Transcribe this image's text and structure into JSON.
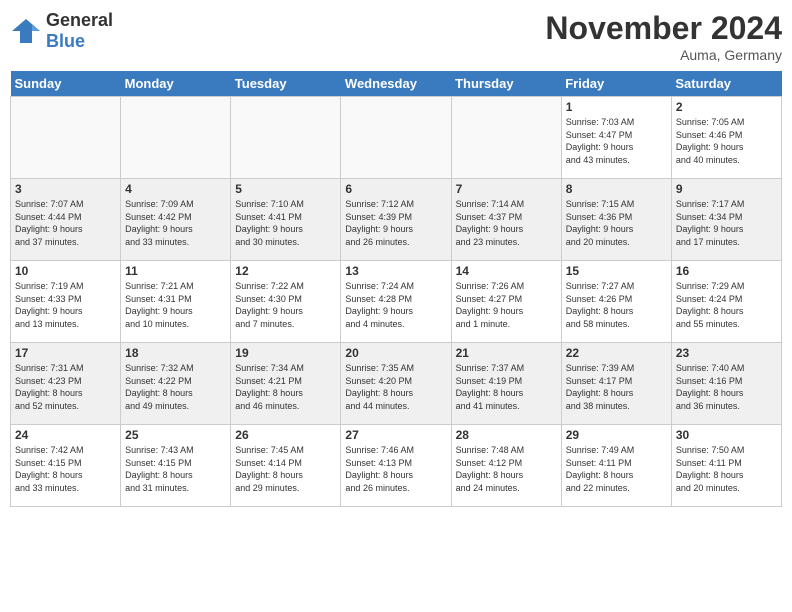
{
  "header": {
    "logo_general": "General",
    "logo_blue": "Blue",
    "month_title": "November 2024",
    "location": "Auma, Germany"
  },
  "days_of_week": [
    "Sunday",
    "Monday",
    "Tuesday",
    "Wednesday",
    "Thursday",
    "Friday",
    "Saturday"
  ],
  "weeks": [
    [
      {
        "day": "",
        "info": ""
      },
      {
        "day": "",
        "info": ""
      },
      {
        "day": "",
        "info": ""
      },
      {
        "day": "",
        "info": ""
      },
      {
        "day": "",
        "info": ""
      },
      {
        "day": "1",
        "info": "Sunrise: 7:03 AM\nSunset: 4:47 PM\nDaylight: 9 hours\nand 43 minutes."
      },
      {
        "day": "2",
        "info": "Sunrise: 7:05 AM\nSunset: 4:46 PM\nDaylight: 9 hours\nand 40 minutes."
      }
    ],
    [
      {
        "day": "3",
        "info": "Sunrise: 7:07 AM\nSunset: 4:44 PM\nDaylight: 9 hours\nand 37 minutes."
      },
      {
        "day": "4",
        "info": "Sunrise: 7:09 AM\nSunset: 4:42 PM\nDaylight: 9 hours\nand 33 minutes."
      },
      {
        "day": "5",
        "info": "Sunrise: 7:10 AM\nSunset: 4:41 PM\nDaylight: 9 hours\nand 30 minutes."
      },
      {
        "day": "6",
        "info": "Sunrise: 7:12 AM\nSunset: 4:39 PM\nDaylight: 9 hours\nand 26 minutes."
      },
      {
        "day": "7",
        "info": "Sunrise: 7:14 AM\nSunset: 4:37 PM\nDaylight: 9 hours\nand 23 minutes."
      },
      {
        "day": "8",
        "info": "Sunrise: 7:15 AM\nSunset: 4:36 PM\nDaylight: 9 hours\nand 20 minutes."
      },
      {
        "day": "9",
        "info": "Sunrise: 7:17 AM\nSunset: 4:34 PM\nDaylight: 9 hours\nand 17 minutes."
      }
    ],
    [
      {
        "day": "10",
        "info": "Sunrise: 7:19 AM\nSunset: 4:33 PM\nDaylight: 9 hours\nand 13 minutes."
      },
      {
        "day": "11",
        "info": "Sunrise: 7:21 AM\nSunset: 4:31 PM\nDaylight: 9 hours\nand 10 minutes."
      },
      {
        "day": "12",
        "info": "Sunrise: 7:22 AM\nSunset: 4:30 PM\nDaylight: 9 hours\nand 7 minutes."
      },
      {
        "day": "13",
        "info": "Sunrise: 7:24 AM\nSunset: 4:28 PM\nDaylight: 9 hours\nand 4 minutes."
      },
      {
        "day": "14",
        "info": "Sunrise: 7:26 AM\nSunset: 4:27 PM\nDaylight: 9 hours\nand 1 minute."
      },
      {
        "day": "15",
        "info": "Sunrise: 7:27 AM\nSunset: 4:26 PM\nDaylight: 8 hours\nand 58 minutes."
      },
      {
        "day": "16",
        "info": "Sunrise: 7:29 AM\nSunset: 4:24 PM\nDaylight: 8 hours\nand 55 minutes."
      }
    ],
    [
      {
        "day": "17",
        "info": "Sunrise: 7:31 AM\nSunset: 4:23 PM\nDaylight: 8 hours\nand 52 minutes."
      },
      {
        "day": "18",
        "info": "Sunrise: 7:32 AM\nSunset: 4:22 PM\nDaylight: 8 hours\nand 49 minutes."
      },
      {
        "day": "19",
        "info": "Sunrise: 7:34 AM\nSunset: 4:21 PM\nDaylight: 8 hours\nand 46 minutes."
      },
      {
        "day": "20",
        "info": "Sunrise: 7:35 AM\nSunset: 4:20 PM\nDaylight: 8 hours\nand 44 minutes."
      },
      {
        "day": "21",
        "info": "Sunrise: 7:37 AM\nSunset: 4:19 PM\nDaylight: 8 hours\nand 41 minutes."
      },
      {
        "day": "22",
        "info": "Sunrise: 7:39 AM\nSunset: 4:17 PM\nDaylight: 8 hours\nand 38 minutes."
      },
      {
        "day": "23",
        "info": "Sunrise: 7:40 AM\nSunset: 4:16 PM\nDaylight: 8 hours\nand 36 minutes."
      }
    ],
    [
      {
        "day": "24",
        "info": "Sunrise: 7:42 AM\nSunset: 4:15 PM\nDaylight: 8 hours\nand 33 minutes."
      },
      {
        "day": "25",
        "info": "Sunrise: 7:43 AM\nSunset: 4:15 PM\nDaylight: 8 hours\nand 31 minutes."
      },
      {
        "day": "26",
        "info": "Sunrise: 7:45 AM\nSunset: 4:14 PM\nDaylight: 8 hours\nand 29 minutes."
      },
      {
        "day": "27",
        "info": "Sunrise: 7:46 AM\nSunset: 4:13 PM\nDaylight: 8 hours\nand 26 minutes."
      },
      {
        "day": "28",
        "info": "Sunrise: 7:48 AM\nSunset: 4:12 PM\nDaylight: 8 hours\nand 24 minutes."
      },
      {
        "day": "29",
        "info": "Sunrise: 7:49 AM\nSunset: 4:11 PM\nDaylight: 8 hours\nand 22 minutes."
      },
      {
        "day": "30",
        "info": "Sunrise: 7:50 AM\nSunset: 4:11 PM\nDaylight: 8 hours\nand 20 minutes."
      }
    ]
  ]
}
